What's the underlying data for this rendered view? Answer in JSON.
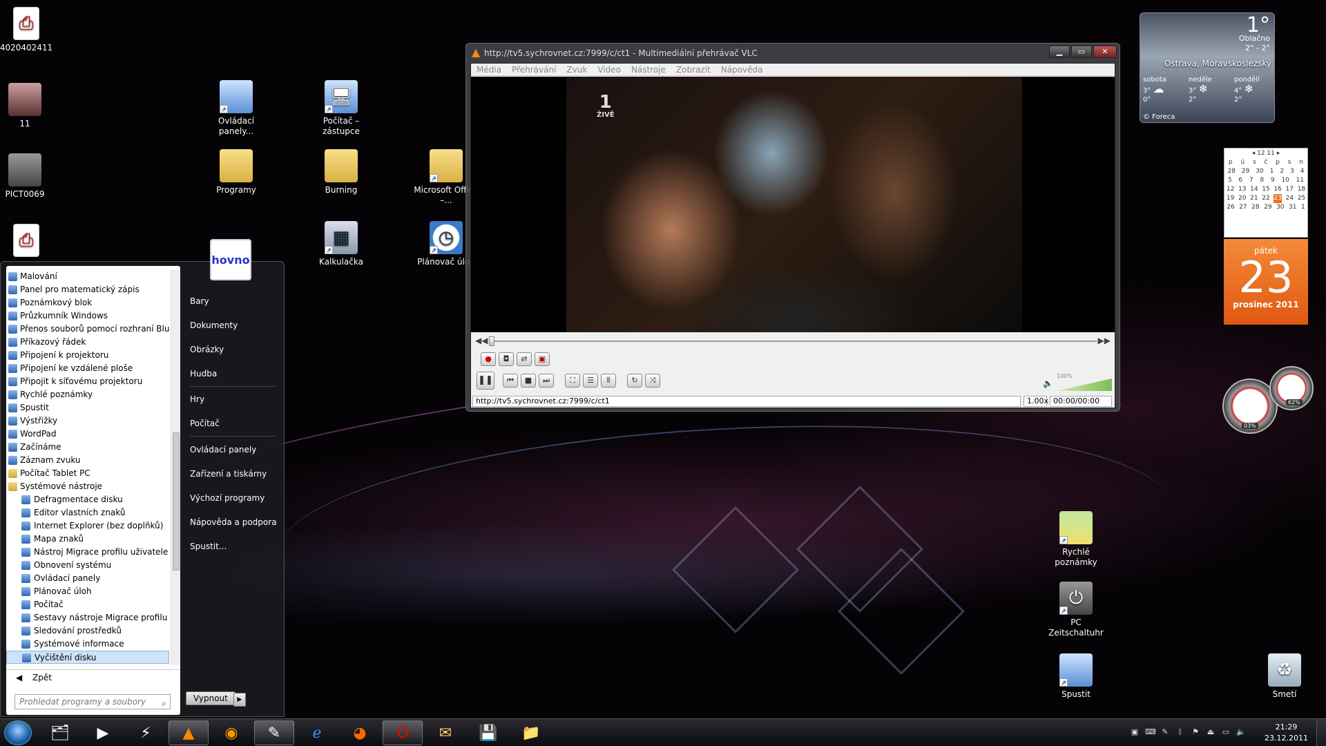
{
  "desktop": {
    "icons": [
      {
        "label": "4020402411",
        "icon": "pdf-icon"
      },
      {
        "label": "11",
        "icon": "photo-icon"
      },
      {
        "label": "PICT0069",
        "icon": "photo-icon"
      },
      {
        "label": "Ovládací panely...",
        "icon": "control-panel-icon"
      },
      {
        "label": "Počítač – zástupce",
        "icon": "computer-icon"
      },
      {
        "label": "Programy",
        "icon": "folder-icon"
      },
      {
        "label": "Burning",
        "icon": "folder-icon"
      },
      {
        "label": "Microsoft Office –...",
        "icon": "folder-icon"
      },
      {
        "label": "Kalkulačka",
        "icon": "calculator-icon"
      },
      {
        "label": "Plánovač úloh",
        "icon": "clock-icon"
      },
      {
        "label": "Rychlé poznámky",
        "icon": "sticky-notes-icon"
      },
      {
        "label": "PC Zeitschaltuhr",
        "icon": "power-icon"
      },
      {
        "label": "Spustit",
        "icon": "run-icon"
      },
      {
        "label": "Smetí",
        "icon": "recycle-bin-icon"
      }
    ]
  },
  "start_menu": {
    "user_picture_text": "hovno",
    "programs": [
      {
        "label": "Malování",
        "level": 0
      },
      {
        "label": "Panel pro matematický zápis",
        "level": 0
      },
      {
        "label": "Poznámkový blok",
        "level": 0
      },
      {
        "label": "Průzkumník Windows",
        "level": 0
      },
      {
        "label": "Přenos souborů pomocí rozhraní Blu",
        "level": 0
      },
      {
        "label": "Příkazový řádek",
        "level": 0
      },
      {
        "label": "Připojení k projektoru",
        "level": 0
      },
      {
        "label": "Připojení ke vzdálené ploše",
        "level": 0
      },
      {
        "label": "Připojit k síťovému projektoru",
        "level": 0
      },
      {
        "label": "Rychlé poznámky",
        "level": 0
      },
      {
        "label": "Spustit",
        "level": 0
      },
      {
        "label": "Výstřižky",
        "level": 0
      },
      {
        "label": "WordPad",
        "level": 0
      },
      {
        "label": "Začínáme",
        "level": 0
      },
      {
        "label": "Záznam zvuku",
        "level": 0
      },
      {
        "label": "Počítač Tablet PC",
        "level": 0,
        "folder": true
      },
      {
        "label": "Systémové nástroje",
        "level": 0,
        "folder": true
      },
      {
        "label": "Defragmentace disku",
        "level": 1
      },
      {
        "label": "Editor vlastních znaků",
        "level": 1
      },
      {
        "label": "Internet Explorer (bez doplňků)",
        "level": 1
      },
      {
        "label": "Mapa znaků",
        "level": 1
      },
      {
        "label": "Nástroj Migrace profilu uživatele",
        "level": 1
      },
      {
        "label": "Obnovení systému",
        "level": 1
      },
      {
        "label": "Ovládací panely",
        "level": 1
      },
      {
        "label": "Plánovač úloh",
        "level": 1
      },
      {
        "label": "Počítač",
        "level": 1
      },
      {
        "label": "Sestavy nástroje Migrace profilu",
        "level": 1
      },
      {
        "label": "Sledování prostředků",
        "level": 1
      },
      {
        "label": "Systémové informace",
        "level": 1
      },
      {
        "label": "Vyčištění disku",
        "level": 1,
        "selected": true
      }
    ],
    "back_label": "Zpět",
    "search_placeholder": "Prohledat programy a soubory",
    "right_items": [
      "Bary",
      "Dokumenty",
      "Obrázky",
      "Hudba",
      "Hry",
      "Počítač",
      "Ovládací panely",
      "Zařízení a tiskárny",
      "Výchozí programy",
      "Nápověda a podpora",
      "Spustit..."
    ],
    "shutdown_label": "Vypnout"
  },
  "vlc": {
    "title": "http://tv5.sychrovnet.cz:7999/c/ct1 - Multimediální přehrávač VLC",
    "menu": [
      "Média",
      "Přehrávání",
      "Zvuk",
      "Video",
      "Nástroje",
      "Zobrazit",
      "Nápověda"
    ],
    "osd_channel": "1",
    "osd_live": "ŽIVĚ",
    "volume_label": "100%",
    "status_url": "http://tv5.sychrovnet.cz:7999/c/ct1",
    "speed": "1.00x",
    "time": "00:00/00:00",
    "window_buttons": [
      "▁",
      "▭",
      "✕"
    ]
  },
  "weather": {
    "temp": "1°",
    "condition": "Oblačno",
    "range": "2° - 2°",
    "city": "Ostrava, Moravskoslezský",
    "forecast": [
      {
        "day": "sobota",
        "hi": "3°",
        "lo": "0°",
        "icon": "cloud-icon"
      },
      {
        "day": "neděle",
        "hi": "3°",
        "lo": "2°",
        "icon": "snow-icon"
      },
      {
        "day": "pondělí",
        "hi": "4°",
        "lo": "2°",
        "icon": "snow-icon"
      }
    ],
    "source": "© Foreca"
  },
  "calendar": {
    "month_header": "12 11",
    "weekdays": [
      "p",
      "ú",
      "s",
      "č",
      "p",
      "s",
      "n"
    ],
    "weeks": [
      [
        "28",
        "29",
        "30",
        "1",
        "2",
        "3",
        "4"
      ],
      [
        "5",
        "6",
        "7",
        "8",
        "9",
        "10",
        "11"
      ],
      [
        "12",
        "13",
        "14",
        "15",
        "16",
        "17",
        "18"
      ],
      [
        "19",
        "20",
        "21",
        "22",
        "23",
        "24",
        "25"
      ],
      [
        "26",
        "27",
        "28",
        "29",
        "30",
        "31",
        "1"
      ]
    ],
    "weekday": "pátek",
    "day": "23",
    "month_year": "prosinec 2011"
  },
  "meters": {
    "cpu": "03%",
    "mem": "62%"
  },
  "taskbar": {
    "apps": [
      "explorer",
      "media-player",
      "winamp",
      "vlc",
      "eye",
      "edit",
      "ie",
      "firefox",
      "opera",
      "mail",
      "save",
      "folder"
    ],
    "time": "21:29",
    "date": "23.12.2011"
  }
}
